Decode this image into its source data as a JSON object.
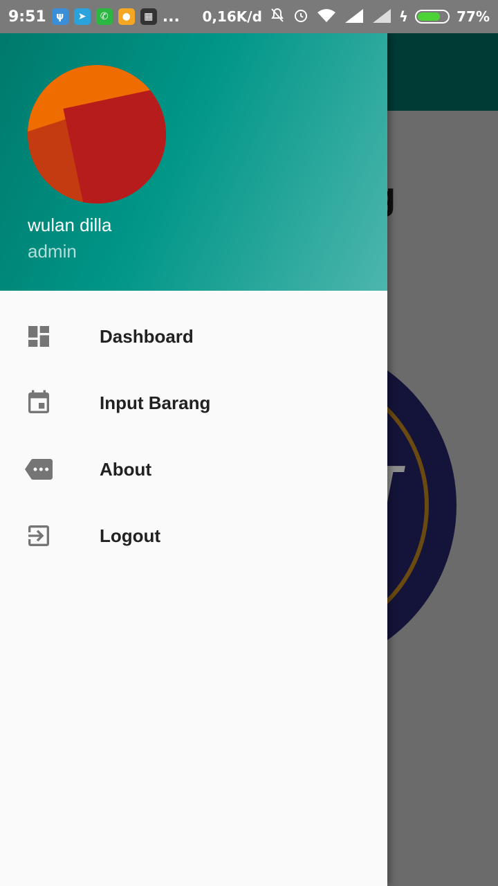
{
  "status_bar": {
    "time": "9:51",
    "notification_icons": [
      "usb-icon",
      "telegram-icon",
      "whatsapp-icon",
      "chat-icon",
      "bbm-icon"
    ],
    "more": "...",
    "network_speed": "0,16K/d",
    "battery_percent": "77%",
    "battery_level": 0.77,
    "colors": {
      "bar": "#7a7a7a",
      "battery_fill": "#4cd137"
    }
  },
  "drawer": {
    "header": {
      "user_name": "wulan dilla",
      "user_role": "admin",
      "colors": {
        "gradient_start": "#00796b",
        "gradient_end": "#4db6ac"
      }
    },
    "menu": [
      {
        "label": "Dashboard",
        "icon": "dashboard-icon"
      },
      {
        "label": "Input Barang",
        "icon": "calendar-icon"
      },
      {
        "label": "About",
        "icon": "tag-more-icon"
      },
      {
        "label": "Logout",
        "icon": "exit-icon"
      }
    ]
  },
  "background_app": {
    "title_fragment": "g",
    "colors": {
      "toolbar": "#003b36",
      "logo": "#14143a"
    }
  }
}
